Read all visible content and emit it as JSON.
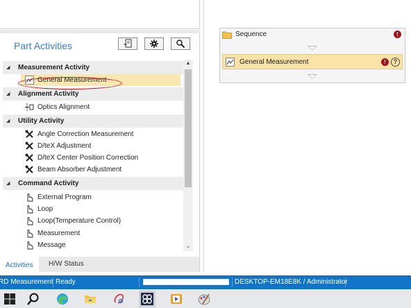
{
  "panel": {
    "title": "Part Activities"
  },
  "tree": {
    "categories": [
      {
        "label": "Measurement Activity",
        "items": [
          "General Measurement"
        ]
      },
      {
        "label": "Alignment Activity",
        "items": [
          "Optics Alignment"
        ]
      },
      {
        "label": "Utility Activity",
        "items": [
          "Angle Correction Measurement",
          "D/teX Adjustment",
          "D/teX Center Position Correction",
          "Beam Absorber Adjustment"
        ]
      },
      {
        "label": "Command Activity",
        "items": [
          "External Program",
          "Loop",
          "Loop(Temperature Control)",
          "Measurement",
          "Message"
        ]
      }
    ],
    "selected": "General Measurement"
  },
  "tabs": {
    "activities": "Activities",
    "hw_status": "H/W Status"
  },
  "sequence": {
    "label": "Sequence",
    "error_mark": "!",
    "child": {
      "label": "General Measurement",
      "error_mark": "!",
      "help_mark": "?"
    }
  },
  "statusbar": {
    "app": "RD Measurement",
    "status": "Ready",
    "machine": "DESKTOP-EM18E8K / Administrator"
  },
  "icons": {
    "toolbar": [
      "document-import-icon",
      "gear-icon",
      "search-icon"
    ],
    "taskbar": [
      "windows-start-icon",
      "search-icon",
      "edge-browser-icon",
      "file-explorer-icon",
      "sketch-app-icon",
      "app-icon",
      "media-player-icon",
      "paint-icon"
    ]
  },
  "colors": {
    "accent": "#3a7fc4",
    "selection": "#f9e7b2",
    "statusbar": "#1074c9",
    "error": "#a5141a",
    "annotation_circle": "#c0161d"
  }
}
